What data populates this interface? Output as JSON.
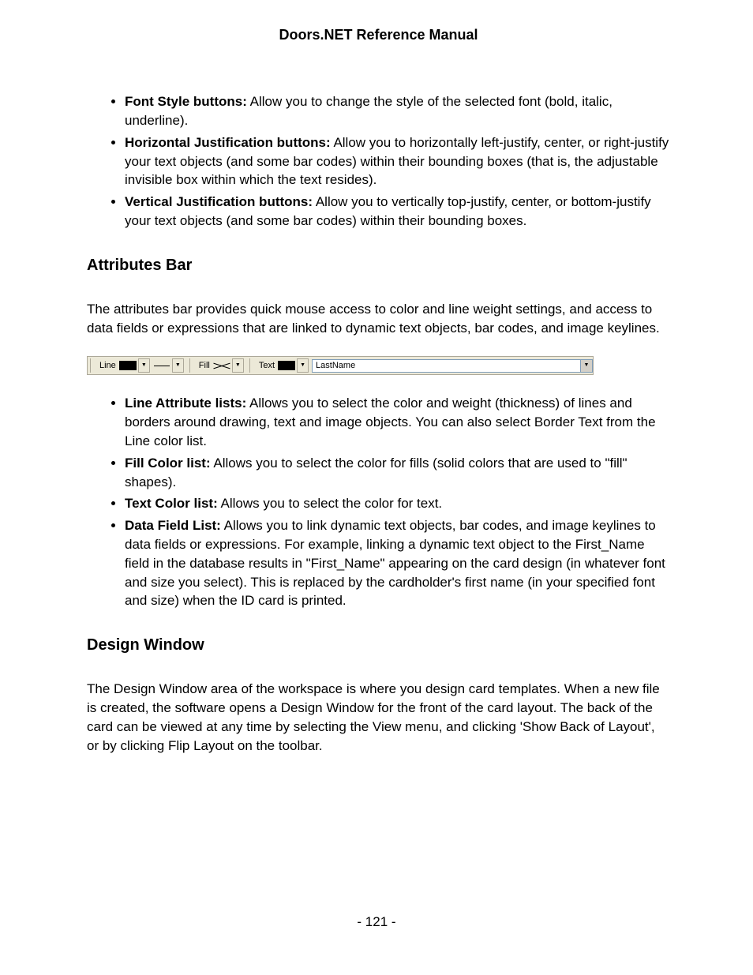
{
  "header": {
    "title": "Doors.NET Reference Manual"
  },
  "footer": {
    "page_number": "- 121 -"
  },
  "top_list": [
    {
      "bold": "Font Style buttons:",
      "text": " Allow you to change the style of the selected font (bold, italic, underline)."
    },
    {
      "bold": "Horizontal Justification buttons:",
      "text": " Allow you to horizontally left-justify, center, or right-justify your text objects (and some bar codes) within their bounding boxes (that is, the adjustable invisible box within which the text resides)."
    },
    {
      "bold": "Vertical Justification buttons:",
      "text": " Allow you to vertically top-justify, center, or bottom-justify your text objects (and some bar codes) within their bounding boxes."
    }
  ],
  "sections": {
    "attributes": {
      "heading": "Attributes Bar",
      "intro": "The attributes bar provides quick mouse access to color and line weight settings, and access to data fields or expressions that are linked to dynamic text objects, bar codes, and image keylines.",
      "toolbar": {
        "line_label": "Line",
        "fill_label": "Fill",
        "text_label": "Text",
        "field_value": "LastName"
      },
      "list": [
        {
          "bold": "Line Attribute lists:",
          "text": " Allows you to select the color and weight (thickness) of lines and borders around drawing, text and image objects. You can also select Border Text from the Line color list."
        },
        {
          "bold": "Fill Color list:",
          "text": " Allows you to select the color for fills (solid colors that are used to \"fill\" shapes)."
        },
        {
          "bold": "Text Color list:",
          "text": " Allows you to select the color for text."
        },
        {
          "bold": "Data Field List:",
          "text": " Allows you to link dynamic text objects, bar codes, and image keylines to data fields or expressions. For example, linking a dynamic text object to the First_Name field in the database results in \"First_Name\" appearing on the card design (in whatever font and size you select). This is replaced by the cardholder's first name (in your specified font and size) when the ID card is printed."
        }
      ]
    },
    "design": {
      "heading": "Design Window",
      "body": "The Design Window area of the workspace is where you design card templates. When a new file is created, the software opens a Design Window for the front of the card layout. The back of the card can be viewed at any time by selecting the View menu, and clicking 'Show Back of Layout', or by clicking Flip Layout on the toolbar."
    }
  }
}
